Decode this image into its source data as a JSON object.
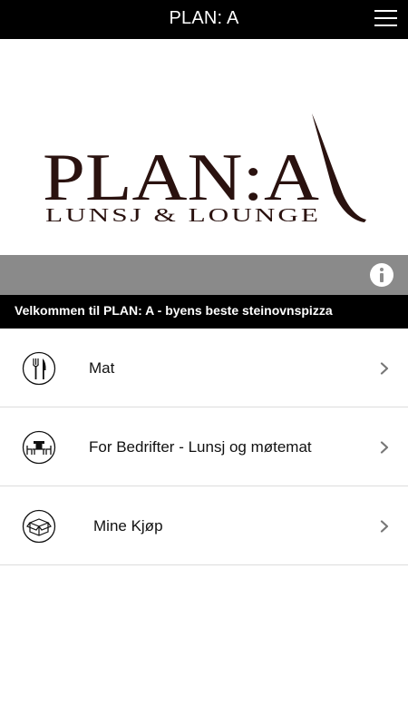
{
  "topbar": {
    "title": "PLAN: A",
    "menu_icon": "hamburger-menu-icon"
  },
  "logo": {
    "wordmark": "PLAN:A",
    "tagline": "LUNSJ & LOUNGE",
    "color": "#2a120f"
  },
  "info": {
    "icon": "info-icon",
    "band_color": "#8a8a8a"
  },
  "welcome": {
    "text": "Velkommen til PLAN: A - byens beste steinovnspizza"
  },
  "menu": {
    "items": [
      {
        "label": "Mat",
        "icon": "cutlery-icon"
      },
      {
        "label": "For Bedrifter - Lunsj og møtemat",
        "icon": "table-chairs-icon"
      },
      {
        "label": "Mine Kjøp",
        "icon": "box-icon"
      }
    ],
    "chevron_icon": "chevron-right-icon"
  }
}
